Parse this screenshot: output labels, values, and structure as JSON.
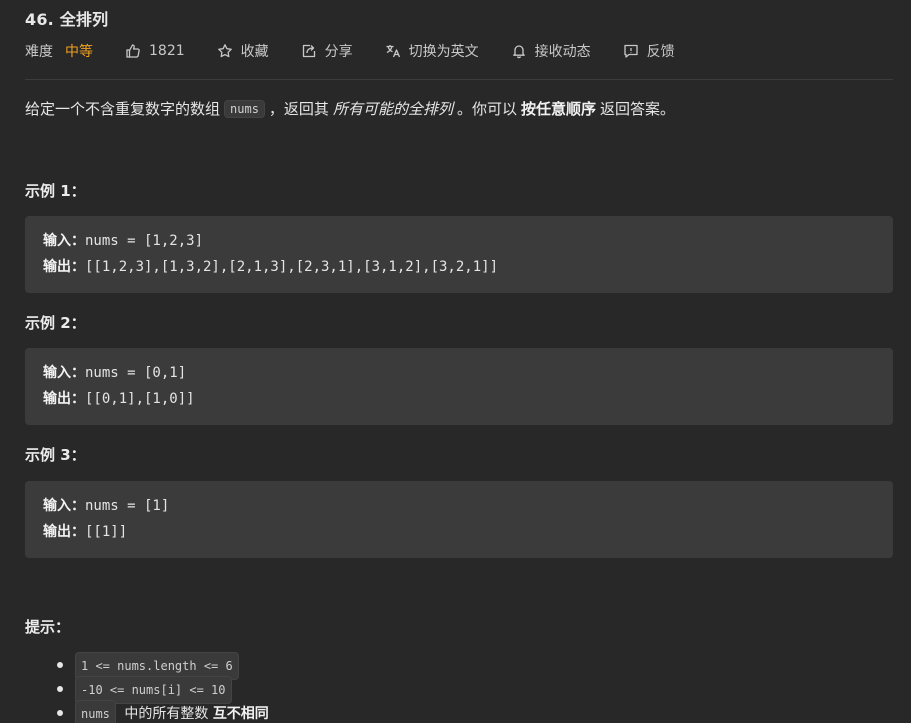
{
  "problem": {
    "title": "46. 全排列"
  },
  "meta": {
    "difficulty_label": "难度",
    "difficulty_value": "中等",
    "likes": "1821",
    "favorite_label": "收藏",
    "share_label": "分享",
    "translate_label": "切换为英文",
    "subscribe_label": "接收动态",
    "feedback_label": "反馈",
    "colors": {
      "difficulty": "#f0a020"
    }
  },
  "description": {
    "part1": "给定一个不含重复数字的数组",
    "code": "nums",
    "part2": "，返回其",
    "emphasis": "所有可能的全排列",
    "part3": "。你可以",
    "strong": "按任意顺序",
    "part4": "返回答案。"
  },
  "examples": [
    {
      "title": "示例 1：",
      "input_label": "输入：",
      "input": "nums = [1,2,3]",
      "output_label": "输出：",
      "output": "[[1,2,3],[1,3,2],[2,1,3],[2,3,1],[3,1,2],[3,2,1]]"
    },
    {
      "title": "示例 2：",
      "input_label": "输入：",
      "input": "nums = [0,1]",
      "output_label": "输出：",
      "output": "[[0,1],[1,0]]"
    },
    {
      "title": "示例 3：",
      "input_label": "输入：",
      "input": "nums = [1]",
      "output_label": "输出：",
      "output": "[[1]]"
    }
  ],
  "hints": {
    "title": "提示：",
    "items": [
      {
        "code": "1 <= nums.length <= 6"
      },
      {
        "code": "-10 <= nums[i] <= 10"
      },
      {
        "code": "nums",
        "text": "中的所有整数",
        "strong": "互不相同"
      }
    ]
  }
}
